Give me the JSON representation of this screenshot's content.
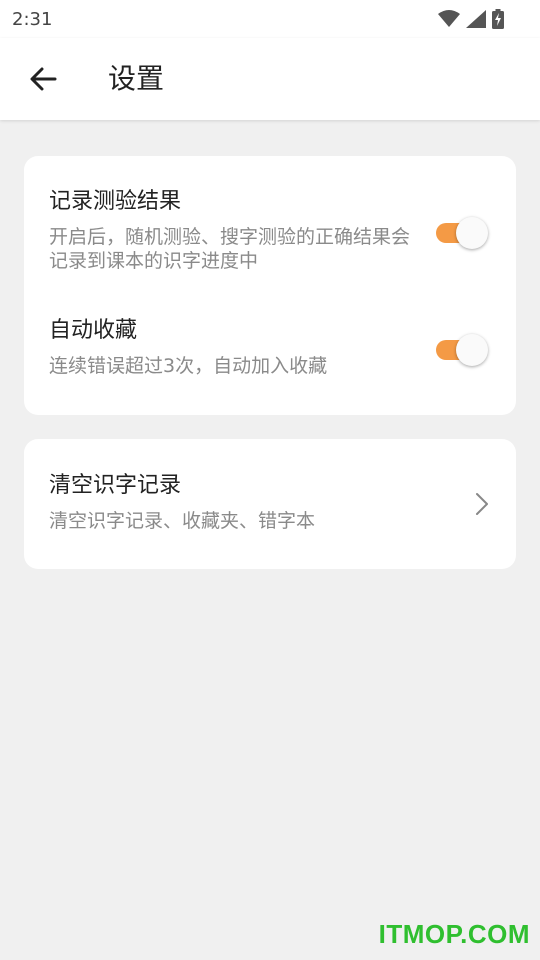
{
  "status_bar": {
    "time": "2:31",
    "icons": [
      "wifi-icon",
      "signal-icon",
      "battery-icon"
    ]
  },
  "app_bar": {
    "back_icon": "arrow-left-icon",
    "title": "设置"
  },
  "settings": {
    "record_results": {
      "title": "记录测验结果",
      "description": "开启后，随机测验、搜字测验的正确结果会记录到课本的识字进度中",
      "enabled": true
    },
    "auto_favorite": {
      "title": "自动收藏",
      "description": "连续错误超过3次，自动加入收藏",
      "enabled": true
    },
    "clear_records": {
      "title": "清空识字记录",
      "description": "清空识字记录、收藏夹、错字本",
      "icon": "chevron-right-icon"
    }
  },
  "colors": {
    "accent": "#f49a45",
    "background": "#f0f0f0",
    "card": "#ffffff"
  },
  "watermark": "ITMOP.COM"
}
